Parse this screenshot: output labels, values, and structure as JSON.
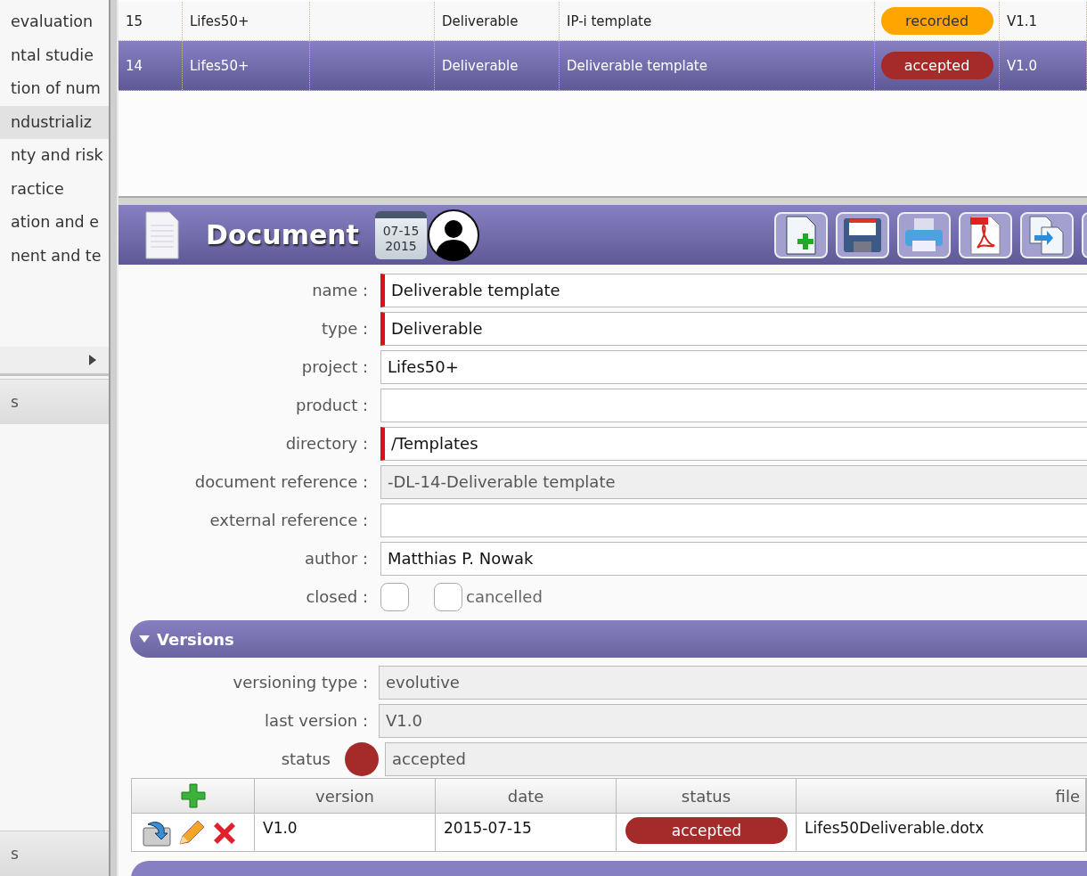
{
  "sidebar": {
    "items": [
      {
        "label": "evaluation",
        "selected": false
      },
      {
        "label": "ntal studie",
        "selected": false
      },
      {
        "label": "tion of num",
        "selected": false
      },
      {
        "label": "ndustrializ",
        "selected": true
      },
      {
        "label": "nty and risk",
        "selected": false
      },
      {
        "label": "ractice",
        "selected": false
      },
      {
        "label": "ation and e",
        "selected": false
      },
      {
        "label": "nent and te",
        "selected": false
      }
    ],
    "panels": [
      {
        "label": "s"
      },
      {
        "label": "s"
      }
    ]
  },
  "grid": {
    "rows": [
      {
        "id": "15",
        "project": "Lifes50+",
        "type": "Deliverable",
        "name": "IP-i template",
        "status": {
          "label": "recorded",
          "color": "#ffa500"
        },
        "version": "V1.1",
        "selected": false
      },
      {
        "id": "14",
        "project": "Lifes50+",
        "type": "Deliverable",
        "name": "Deliverable template",
        "status": {
          "label": "accepted",
          "color": "#a52a2a"
        },
        "version": "V1.0",
        "selected": true
      }
    ]
  },
  "document": {
    "title": "Document",
    "calendar": {
      "day": "07-15",
      "year": "2015"
    },
    "fields": [
      {
        "label": "name :",
        "value": "Deliverable template",
        "required": true,
        "disabled": false
      },
      {
        "label": "type :",
        "value": "Deliverable",
        "required": true,
        "disabled": false
      },
      {
        "label": "project :",
        "value": "Lifes50+",
        "required": false,
        "disabled": false
      },
      {
        "label": "product :",
        "required": false,
        "disabled": false
      },
      {
        "label": "directory :",
        "value": "/Templates",
        "required": true,
        "disabled": false
      },
      {
        "label": "document reference :",
        "value": "-DL-14-Deliverable template",
        "required": false,
        "disabled": true
      },
      {
        "label": "external reference :",
        "required": false,
        "disabled": false
      },
      {
        "label": "author :",
        "value": "Matthias P. Nowak",
        "required": false,
        "disabled": false
      }
    ],
    "closed": {
      "label": "closed :",
      "checked": false
    },
    "cancelled": {
      "label": "cancelled",
      "checked": false
    }
  },
  "versions": {
    "title": "Versions",
    "expanded": true,
    "fields": [
      {
        "label": "versioning type :",
        "value": "evolutive"
      },
      {
        "label": "last version :",
        "value": "V1.0"
      }
    ],
    "status": {
      "label": "status",
      "value": "accepted",
      "color": "#a52a2a"
    },
    "table": {
      "columns": [
        "version",
        "date",
        "status",
        "file"
      ],
      "rows": [
        {
          "version": "V1.0",
          "date": "2015-07-15",
          "status": {
            "label": "accepted",
            "color": "#a52a2a"
          },
          "file": "Lifes50Deliverable.dotx"
        }
      ]
    }
  }
}
